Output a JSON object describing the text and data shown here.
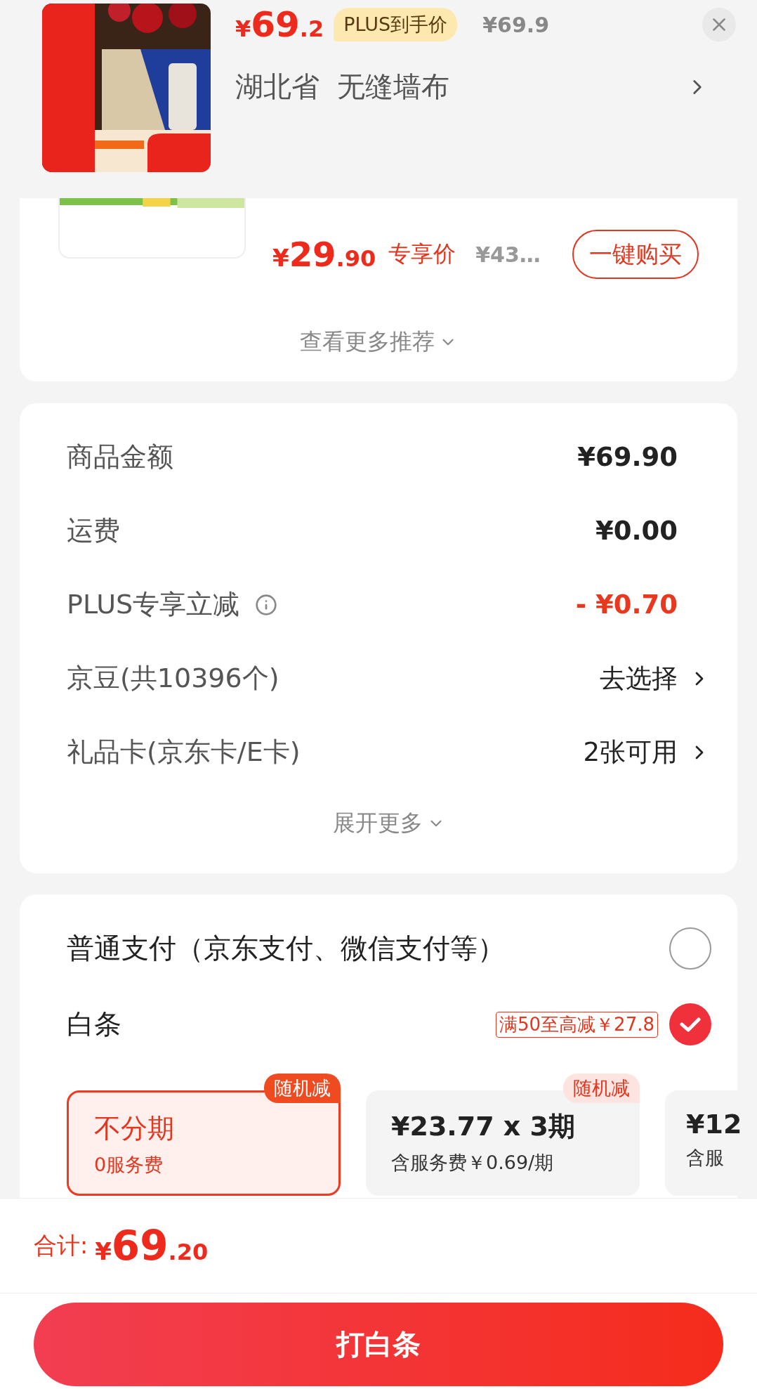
{
  "header": {
    "price_symbol": "¥",
    "price_int": "69",
    "price_dec": ".2",
    "badge": "PLUS到手价",
    "original_price": "¥69.9",
    "address": "湖北省  无缝墙布"
  },
  "recommendation": {
    "price_symbol": "¥",
    "price_int": "29",
    "price_dec": ".90",
    "price_label": "专享价",
    "original_price": "¥43…",
    "buy_button": "一键购买",
    "more": "查看更多推荐"
  },
  "summary": {
    "rows": [
      {
        "label": "商品金额",
        "value": "¥69.90",
        "kind": "amount"
      },
      {
        "label": "运费",
        "value": "¥0.00",
        "kind": "amount"
      },
      {
        "label": "PLUS专享立减",
        "value": "- ¥0.70",
        "kind": "discount",
        "info": true
      },
      {
        "label": "京豆(共10396个)",
        "value": "去选择",
        "kind": "link"
      },
      {
        "label": "礼品卡(京东卡/E卡)",
        "value": "2张可用",
        "kind": "link"
      }
    ],
    "more": "展开更多"
  },
  "payment": {
    "options": [
      {
        "label": "普通支付（京东支付、微信支付等）",
        "selected": false
      },
      {
        "label": "白条",
        "promo": "满50至高减￥27.8",
        "selected": true
      }
    ],
    "plans": [
      {
        "title": "不分期",
        "subtitle": "0服务费",
        "tag": "随机减",
        "selected": true
      },
      {
        "title": "¥23.77 x 3期",
        "subtitle": "含服务费￥0.69/期",
        "tag": "随机减",
        "selected": false
      },
      {
        "title": "¥12",
        "subtitle": "含服",
        "selected": false
      }
    ]
  },
  "total": {
    "label": "合计:",
    "symbol": "¥",
    "int": "69",
    "dec": ".20"
  },
  "submit": "打白条"
}
